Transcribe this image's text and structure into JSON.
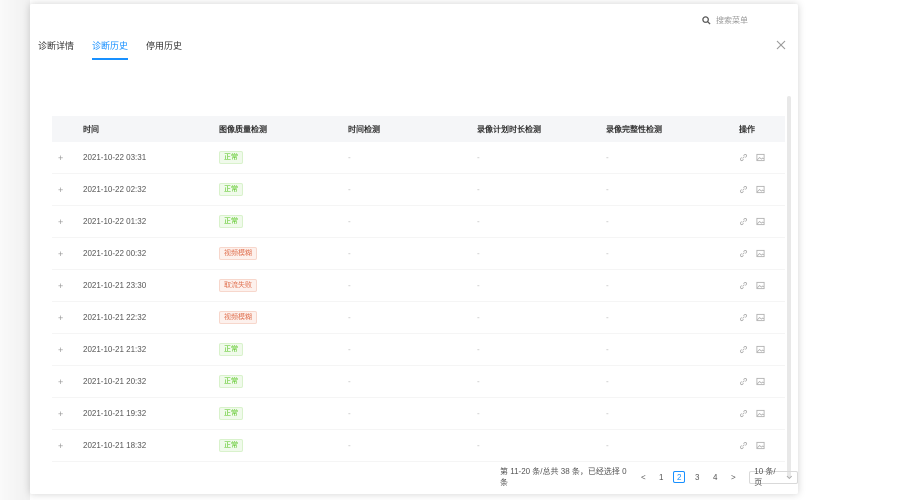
{
  "search": {
    "placeholder": "搜索菜单"
  },
  "tabs": [
    {
      "label": "诊断详情"
    },
    {
      "label": "诊断历史"
    },
    {
      "label": "停用历史"
    }
  ],
  "table": {
    "headers": {
      "time": "时间",
      "image_quality": "图像质量检测",
      "clock": "时间检测",
      "plan_duration": "录像计划时长检测",
      "integrity": "录像完整性检测",
      "ops": "操作"
    },
    "rows": [
      {
        "time": "2021-10-22 03:31",
        "status": "正常",
        "clock": "-",
        "plan": "-",
        "integrity": "-"
      },
      {
        "time": "2021-10-22 02:32",
        "status": "正常",
        "clock": "-",
        "plan": "-",
        "integrity": "-"
      },
      {
        "time": "2021-10-22 01:32",
        "status": "正常",
        "clock": "-",
        "plan": "-",
        "integrity": "-"
      },
      {
        "time": "2021-10-22 00:32",
        "status": "视频模糊",
        "clock": "-",
        "plan": "-",
        "integrity": "-"
      },
      {
        "time": "2021-10-21 23:30",
        "status": "取流失败",
        "clock": "-",
        "plan": "-",
        "integrity": "-"
      },
      {
        "time": "2021-10-21 22:32",
        "status": "视频模糊",
        "clock": "-",
        "plan": "-",
        "integrity": "-"
      },
      {
        "time": "2021-10-21 21:32",
        "status": "正常",
        "clock": "-",
        "plan": "-",
        "integrity": "-"
      },
      {
        "time": "2021-10-21 20:32",
        "status": "正常",
        "clock": "-",
        "plan": "-",
        "integrity": "-"
      },
      {
        "time": "2021-10-21 19:32",
        "status": "正常",
        "clock": "-",
        "plan": "-",
        "integrity": "-"
      },
      {
        "time": "2021-10-21 18:32",
        "status": "正常",
        "clock": "-",
        "plan": "-",
        "integrity": "-"
      }
    ]
  },
  "pagination": {
    "summary": "第 11-20 条/总共 38 条，已经选择 0 条",
    "prev": "<",
    "pages": [
      "1",
      "2",
      "3",
      "4"
    ],
    "next": ">",
    "page_size": "10 条/页"
  },
  "colors": {
    "accent": "#1890ff",
    "ok": "#52c41a",
    "error": "#e0704f"
  }
}
